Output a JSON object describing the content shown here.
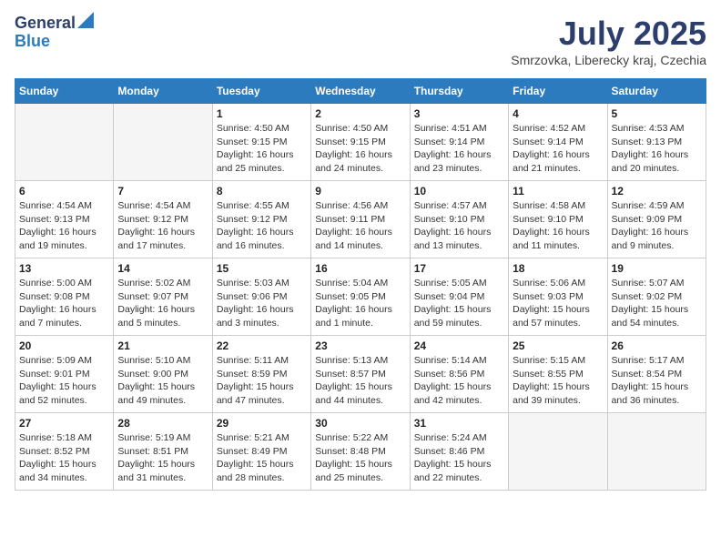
{
  "header": {
    "logo_line1": "General",
    "logo_line2": "Blue",
    "month_title": "July 2025",
    "location": "Smrzovka, Liberecky kraj, Czechia"
  },
  "weekdays": [
    "Sunday",
    "Monday",
    "Tuesday",
    "Wednesday",
    "Thursday",
    "Friday",
    "Saturday"
  ],
  "weeks": [
    [
      {
        "day": "",
        "detail": ""
      },
      {
        "day": "",
        "detail": ""
      },
      {
        "day": "1",
        "detail": "Sunrise: 4:50 AM\nSunset: 9:15 PM\nDaylight: 16 hours and 25 minutes."
      },
      {
        "day": "2",
        "detail": "Sunrise: 4:50 AM\nSunset: 9:15 PM\nDaylight: 16 hours and 24 minutes."
      },
      {
        "day": "3",
        "detail": "Sunrise: 4:51 AM\nSunset: 9:14 PM\nDaylight: 16 hours and 23 minutes."
      },
      {
        "day": "4",
        "detail": "Sunrise: 4:52 AM\nSunset: 9:14 PM\nDaylight: 16 hours and 21 minutes."
      },
      {
        "day": "5",
        "detail": "Sunrise: 4:53 AM\nSunset: 9:13 PM\nDaylight: 16 hours and 20 minutes."
      }
    ],
    [
      {
        "day": "6",
        "detail": "Sunrise: 4:54 AM\nSunset: 9:13 PM\nDaylight: 16 hours and 19 minutes."
      },
      {
        "day": "7",
        "detail": "Sunrise: 4:54 AM\nSunset: 9:12 PM\nDaylight: 16 hours and 17 minutes."
      },
      {
        "day": "8",
        "detail": "Sunrise: 4:55 AM\nSunset: 9:12 PM\nDaylight: 16 hours and 16 minutes."
      },
      {
        "day": "9",
        "detail": "Sunrise: 4:56 AM\nSunset: 9:11 PM\nDaylight: 16 hours and 14 minutes."
      },
      {
        "day": "10",
        "detail": "Sunrise: 4:57 AM\nSunset: 9:10 PM\nDaylight: 16 hours and 13 minutes."
      },
      {
        "day": "11",
        "detail": "Sunrise: 4:58 AM\nSunset: 9:10 PM\nDaylight: 16 hours and 11 minutes."
      },
      {
        "day": "12",
        "detail": "Sunrise: 4:59 AM\nSunset: 9:09 PM\nDaylight: 16 hours and 9 minutes."
      }
    ],
    [
      {
        "day": "13",
        "detail": "Sunrise: 5:00 AM\nSunset: 9:08 PM\nDaylight: 16 hours and 7 minutes."
      },
      {
        "day": "14",
        "detail": "Sunrise: 5:02 AM\nSunset: 9:07 PM\nDaylight: 16 hours and 5 minutes."
      },
      {
        "day": "15",
        "detail": "Sunrise: 5:03 AM\nSunset: 9:06 PM\nDaylight: 16 hours and 3 minutes."
      },
      {
        "day": "16",
        "detail": "Sunrise: 5:04 AM\nSunset: 9:05 PM\nDaylight: 16 hours and 1 minute."
      },
      {
        "day": "17",
        "detail": "Sunrise: 5:05 AM\nSunset: 9:04 PM\nDaylight: 15 hours and 59 minutes."
      },
      {
        "day": "18",
        "detail": "Sunrise: 5:06 AM\nSunset: 9:03 PM\nDaylight: 15 hours and 57 minutes."
      },
      {
        "day": "19",
        "detail": "Sunrise: 5:07 AM\nSunset: 9:02 PM\nDaylight: 15 hours and 54 minutes."
      }
    ],
    [
      {
        "day": "20",
        "detail": "Sunrise: 5:09 AM\nSunset: 9:01 PM\nDaylight: 15 hours and 52 minutes."
      },
      {
        "day": "21",
        "detail": "Sunrise: 5:10 AM\nSunset: 9:00 PM\nDaylight: 15 hours and 49 minutes."
      },
      {
        "day": "22",
        "detail": "Sunrise: 5:11 AM\nSunset: 8:59 PM\nDaylight: 15 hours and 47 minutes."
      },
      {
        "day": "23",
        "detail": "Sunrise: 5:13 AM\nSunset: 8:57 PM\nDaylight: 15 hours and 44 minutes."
      },
      {
        "day": "24",
        "detail": "Sunrise: 5:14 AM\nSunset: 8:56 PM\nDaylight: 15 hours and 42 minutes."
      },
      {
        "day": "25",
        "detail": "Sunrise: 5:15 AM\nSunset: 8:55 PM\nDaylight: 15 hours and 39 minutes."
      },
      {
        "day": "26",
        "detail": "Sunrise: 5:17 AM\nSunset: 8:54 PM\nDaylight: 15 hours and 36 minutes."
      }
    ],
    [
      {
        "day": "27",
        "detail": "Sunrise: 5:18 AM\nSunset: 8:52 PM\nDaylight: 15 hours and 34 minutes."
      },
      {
        "day": "28",
        "detail": "Sunrise: 5:19 AM\nSunset: 8:51 PM\nDaylight: 15 hours and 31 minutes."
      },
      {
        "day": "29",
        "detail": "Sunrise: 5:21 AM\nSunset: 8:49 PM\nDaylight: 15 hours and 28 minutes."
      },
      {
        "day": "30",
        "detail": "Sunrise: 5:22 AM\nSunset: 8:48 PM\nDaylight: 15 hours and 25 minutes."
      },
      {
        "day": "31",
        "detail": "Sunrise: 5:24 AM\nSunset: 8:46 PM\nDaylight: 15 hours and 22 minutes."
      },
      {
        "day": "",
        "detail": ""
      },
      {
        "day": "",
        "detail": ""
      }
    ]
  ]
}
